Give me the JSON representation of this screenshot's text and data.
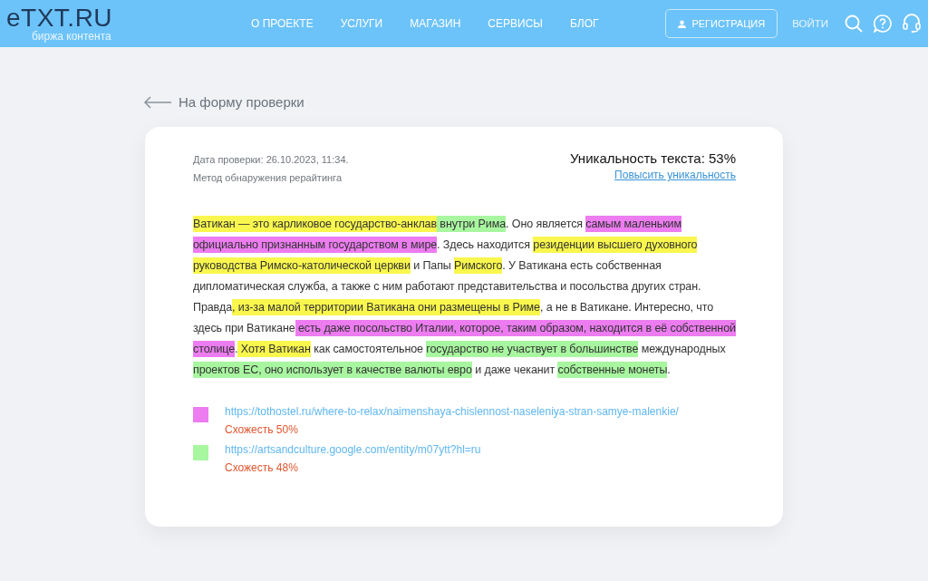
{
  "header": {
    "logo": "eTXT.RU",
    "tagline": "биржа контента",
    "nav": [
      "О ПРОЕКТЕ",
      "УСЛУГИ",
      "МАГАЗИН",
      "СЕРВИСЫ",
      "БЛОГ"
    ],
    "register": "РЕГИСТРАЦИЯ",
    "login": "ВОЙТИ"
  },
  "back_link": "На форму проверки",
  "report": {
    "date": "Дата проверки: 26.10.2023, 11:34.",
    "method": "Метод обнаружения рерайтинга",
    "uniqueness": "Уникальность текста: 53%",
    "improve_link": "Повысить уникальность",
    "text_segments": [
      {
        "text": "Ватикан — это карликовое государство-анклав",
        "color": "#f9f74d"
      },
      {
        "text": " внутри Рима",
        "color": "#a8f7a0"
      },
      {
        "text": ". Оно является "
      },
      {
        "text": "самым маленьким официально признанным государством в мире",
        "color": "#ec7cf0"
      },
      {
        "text": ". Здесь находится "
      },
      {
        "text": "резиденции высшего духовного руководства Римско-католической церкви",
        "color": "#f9f74d"
      },
      {
        "text": " и Папы "
      },
      {
        "text": "Римского",
        "color": "#f9f74d"
      },
      {
        "text": ". У Ватикана есть собственная дипломатическая служба, а также с ним работают представительства и посольства других стран. Правда"
      },
      {
        "text": ", из-за малой территории Ватикана они размещены в Риме",
        "color": "#f9f74d"
      },
      {
        "text": ", а не в Ватикане. Интересно, что здесь при Ватикане"
      },
      {
        "text": " есть даже посольство Италии, которое, таким образом, находится в её собственной столице",
        "color": "#ec7cf0"
      },
      {
        "text": "."
      },
      {
        "text": " Хотя Ватикан",
        "color": "#f9f74d"
      },
      {
        "text": " как самостоятельное "
      },
      {
        "text": "государство не участвует в большинстве",
        "color": "#a8f7a0"
      },
      {
        "text": " международных"
      },
      {
        "text": " проектов ЕС, оно использует в качестве валюты евро",
        "color": "#a8f7a0"
      },
      {
        "text": " и даже чеканит "
      },
      {
        "text": "собственные монеты",
        "color": "#a8f7a0"
      },
      {
        "text": "."
      }
    ],
    "sources": [
      {
        "url": "https://tothostel.ru/where-to-relax/naimenshaya-chislennost-naseleniya-stran-samye-malenkie/",
        "similarity": "Схожесть 50%",
        "color": "#ec7cf0"
      },
      {
        "url": "https://artsandculture.google.com/entity/m07ytt?hl=ru",
        "similarity": "Схожесть 48%",
        "color": "#a8f7a0"
      }
    ]
  }
}
